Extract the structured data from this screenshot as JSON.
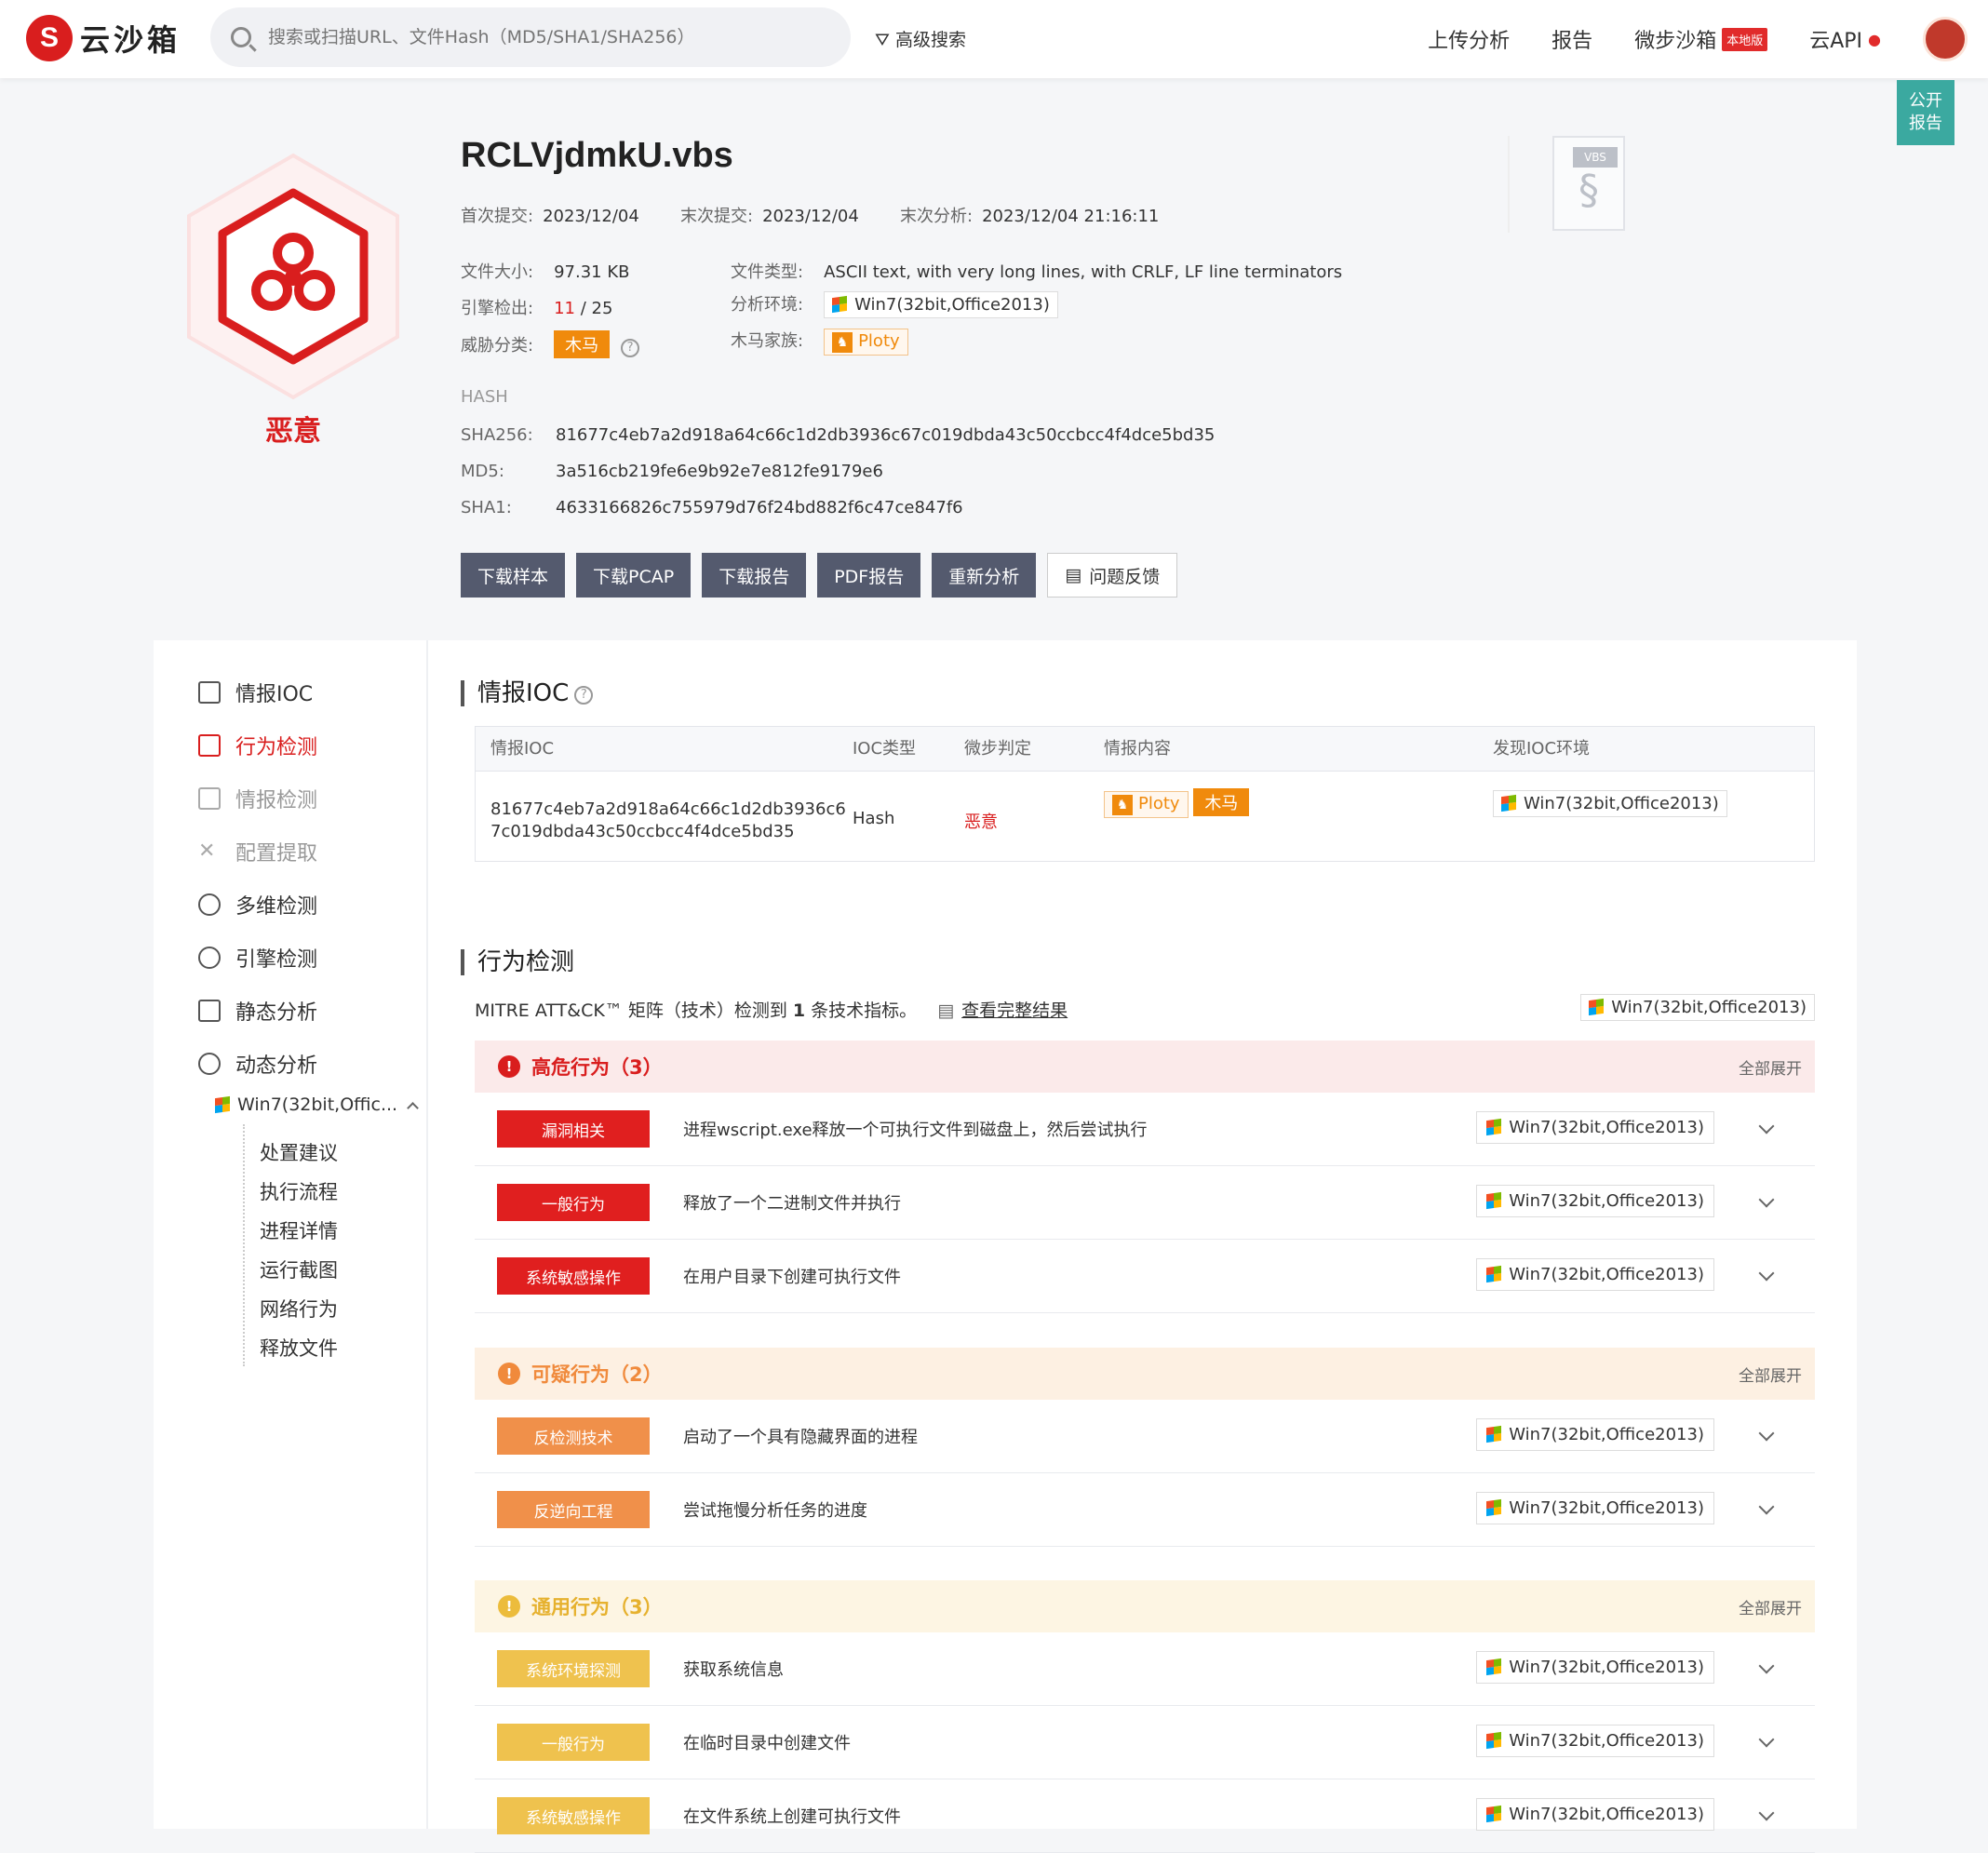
{
  "header": {
    "logo_text": "云沙箱",
    "search_placeholder": "搜索或扫描URL、文件Hash（MD5/SHA1/SHA256）",
    "advanced_search": "高级搜索",
    "nav": {
      "upload": "上传分析",
      "report": "报告",
      "weibu": "微步沙箱",
      "local_badge": "本地版",
      "api": "云API"
    }
  },
  "public_report": [
    "公开",
    "报告"
  ],
  "file": {
    "verdict": "恶意",
    "name": "RCLVjdmkU.vbs",
    "first_submit_label": "首次提交:",
    "first_submit": "2023/12/04",
    "last_submit_label": "末次提交:",
    "last_submit": "2023/12/04",
    "last_analysis_label": "末次分析:",
    "last_analysis": "2023/12/04 21:16:11",
    "size_label": "文件大小:",
    "size": "97.31 KB",
    "type_label": "文件类型:",
    "type": "ASCII text, with very long lines, with CRLF, LF line terminators",
    "engine_label": "引擎检出:",
    "engine_hit": "11",
    "engine_total": " / 25",
    "env_label": "分析环境:",
    "env": "Win7(32bit,Office2013)",
    "threat_label": "威胁分类:",
    "threat": "木马",
    "family_label": "木马家族:",
    "family": "Ploty",
    "hash_title": "HASH",
    "sha256_label": "SHA256:",
    "sha256": "81677c4eb7a2d918a64c66c1d2db3936c67c019dbda43c50ccbcc4f4dce5bd35",
    "md5_label": "MD5:",
    "md5": "3a516cb219fe6e9b92e7e812fe9179e6",
    "sha1_label": "SHA1:",
    "sha1": "4633166826c755979d76f24bd882f6c47ce847f6",
    "icon_label": "VBS"
  },
  "buttons": [
    "下载样本",
    "下载PCAP",
    "下载报告",
    "PDF报告",
    "重新分析",
    "问题反馈"
  ],
  "sidebar": {
    "items": [
      "情报IOC",
      "行为检测",
      "情报检测",
      "配置提取",
      "多维检测",
      "引擎检测",
      "静态分析",
      "动态分析"
    ],
    "env": "Win7(32bit,Offic...",
    "sub": [
      "处置建议",
      "执行流程",
      "进程详情",
      "运行截图",
      "网络行为",
      "释放文件"
    ]
  },
  "ioc": {
    "title": "情报IOC",
    "columns": [
      "情报IOC",
      "IOC类型",
      "微步判定",
      "情报内容",
      "发现IOC环境"
    ],
    "row": {
      "ioc_l1": "81677c4eb7a2d918a64c66c1d2db3936c6",
      "ioc_l2": "7c019dbda43c50ccbcc4f4dce5bd35",
      "type": "Hash",
      "verdict": "恶意",
      "family": "Ploty",
      "threat": "木马",
      "env": "Win7(32bit,Office2013)"
    }
  },
  "behavior": {
    "title": "行为检测",
    "mitre_pre": "MITRE ATT&CK™ 矩阵（技术）检测到",
    "mitre_count": "1",
    "mitre_post": "条技术指标。",
    "view_full": "查看完整结果",
    "env": "Win7(32bit,Office2013)",
    "expand_all": "全部展开",
    "groups": [
      {
        "title": "高危行为（3）",
        "items": [
          {
            "tag": "漏洞相关",
            "desc": "进程wscript.exe释放一个可执行文件到磁盘上，然后尝试执行",
            "env": "Win7(32bit,Office2013)"
          },
          {
            "tag": "一般行为",
            "desc": "释放了一个二进制文件并执行",
            "env": "Win7(32bit,Office2013)"
          },
          {
            "tag": "系统敏感操作",
            "desc": "在用户目录下创建可执行文件",
            "env": "Win7(32bit,Office2013)"
          }
        ]
      },
      {
        "title": "可疑行为（2）",
        "items": [
          {
            "tag": "反检测技术",
            "desc": "启动了一个具有隐藏界面的进程",
            "env": "Win7(32bit,Office2013)"
          },
          {
            "tag": "反逆向工程",
            "desc": "尝试拖慢分析任务的进度",
            "env": "Win7(32bit,Office2013)"
          }
        ]
      },
      {
        "title": "通用行为（3）",
        "items": [
          {
            "tag": "系统环境探测",
            "desc": "获取系统信息",
            "env": "Win7(32bit,Office2013)"
          },
          {
            "tag": "一般行为",
            "desc": "在临时目录中创建文件",
            "env": "Win7(32bit,Office2013)"
          },
          {
            "tag": "系统敏感操作",
            "desc": "在文件系统上创建可执行文件",
            "env": "Win7(32bit,Office2013)"
          }
        ]
      }
    ]
  }
}
